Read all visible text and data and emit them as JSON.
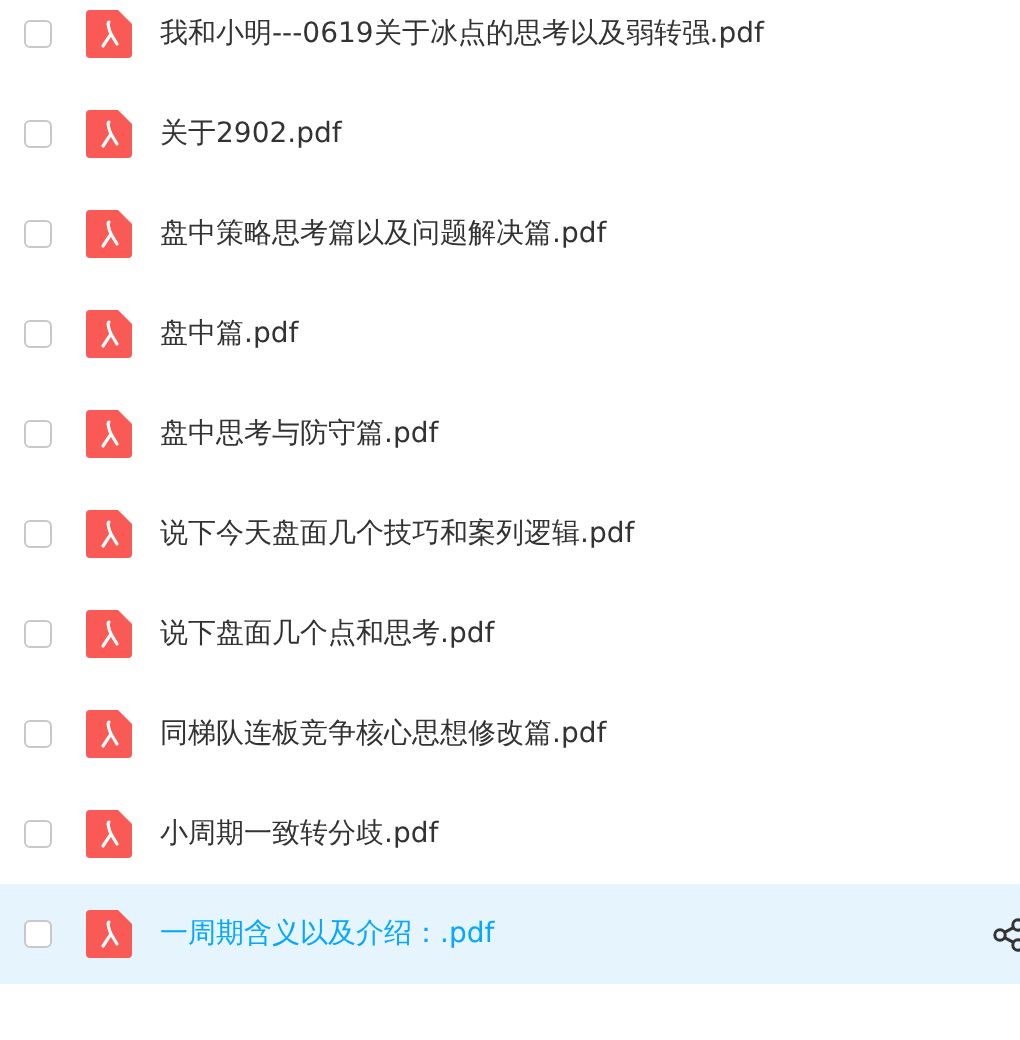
{
  "files": [
    {
      "name": "我和小明---0619关于冰点的思考以及弱转强.pdf",
      "checked": false,
      "highlighted": false
    },
    {
      "name": "关于2902.pdf",
      "checked": false,
      "highlighted": false
    },
    {
      "name": "盘中策略思考篇以及问题解决篇.pdf",
      "checked": false,
      "highlighted": false
    },
    {
      "name": "盘中篇.pdf",
      "checked": false,
      "highlighted": false
    },
    {
      "name": "盘中思考与防守篇.pdf",
      "checked": false,
      "highlighted": false
    },
    {
      "name": "说下今天盘面几个技巧和案列逻辑.pdf",
      "checked": false,
      "highlighted": false
    },
    {
      "name": "说下盘面几个点和思考.pdf",
      "checked": false,
      "highlighted": false
    },
    {
      "name": "同梯队连板竞争核心思想修改篇.pdf",
      "checked": false,
      "highlighted": false
    },
    {
      "name": "小周期一致转分歧.pdf",
      "checked": false,
      "highlighted": false
    },
    {
      "name": "一周期含义以及介绍：.pdf",
      "checked": false,
      "highlighted": true
    }
  ]
}
